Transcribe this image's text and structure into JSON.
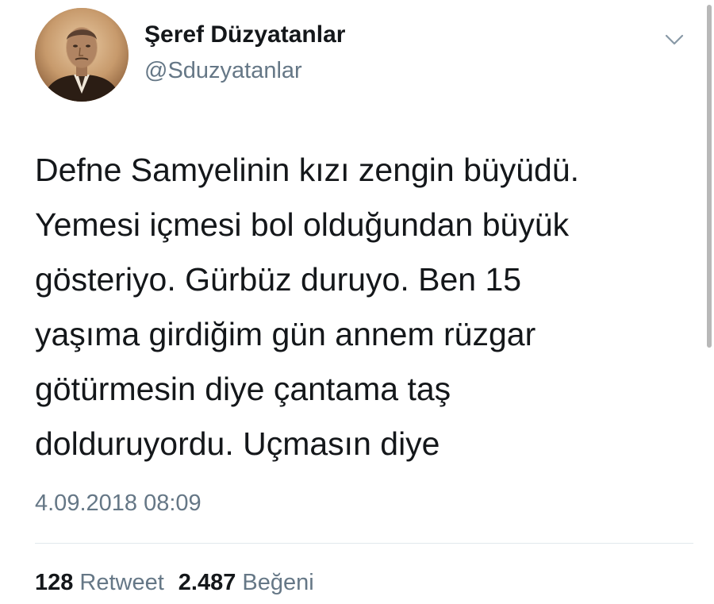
{
  "tweet": {
    "author": {
      "display_name": "Şeref Düzyatanlar",
      "handle": "@Sduzyatanlar",
      "avatar_icon": "vintage-portrait-avatar"
    },
    "menu_icon": "chevron-down-icon",
    "text_lines": [
      "Defne Samyelinin kızı zengin büyüdü.",
      "Yemesi içmesi bol olduğundan büyük",
      "gösteriyo. Gürbüz duruyo. Ben 15",
      "yaşıma girdiğim gün annem rüzgar",
      "götürmesin diye çantama taş",
      "dolduruyordu. Uçmasın diye"
    ],
    "timestamp": "4.09.2018 08:09",
    "stats": {
      "retweet_count": "128",
      "retweet_label": "Retweet",
      "like_count": "2.487",
      "like_label": "Beğeni"
    }
  },
  "colors": {
    "text_primary": "#14171a",
    "text_secondary": "#657786",
    "divider": "#e1e8ed"
  }
}
